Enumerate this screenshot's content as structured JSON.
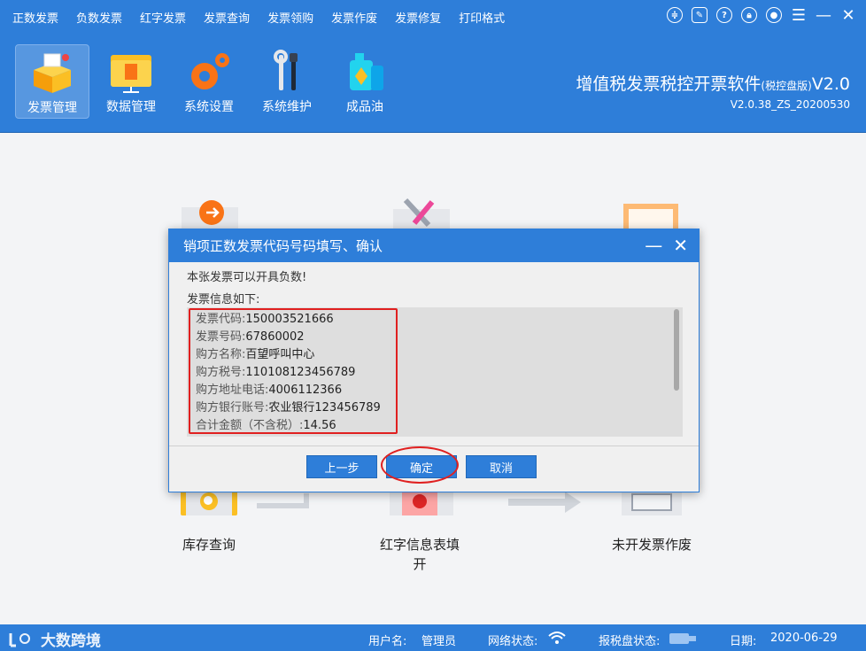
{
  "menu": [
    "正数发票",
    "负数发票",
    "红字发票",
    "发票查询",
    "发票领购",
    "发票作废",
    "发票修复",
    "打印格式"
  ],
  "toolbar": {
    "items": [
      {
        "label": "发票管理",
        "icon": "invoice-box-icon"
      },
      {
        "label": "数据管理",
        "icon": "folder-data-icon"
      },
      {
        "label": "系统设置",
        "icon": "gears-icon"
      },
      {
        "label": "系统维护",
        "icon": "tools-icon"
      },
      {
        "label": "成品油",
        "icon": "oil-can-icon"
      }
    ],
    "title": "增值税发票税控开票软件",
    "title_sub": "(税控盘版)",
    "title_ver": "V2.0",
    "version": "V2.0.38_ZS_20200530"
  },
  "main": {
    "functions": [
      {
        "label": "库存查询"
      },
      {
        "label": "红字信息表填"
      },
      {
        "label": "开"
      },
      {
        "label": "未开发票作废"
      }
    ]
  },
  "dialog": {
    "title": "销项正数发票代码号码填写、确认",
    "notice": "本张发票可以开具负数!",
    "info_heading": "发票信息如下:",
    "fields": [
      {
        "key": "发票代码:",
        "value": "150003521666"
      },
      {
        "key": "发票号码:",
        "value": "67860002"
      },
      {
        "key": "购方名称:",
        "value": "百望呼叫中心"
      },
      {
        "key": "购方税号:",
        "value": "110108123456789"
      },
      {
        "key": "购方地址电话:",
        "value": "4006112366"
      },
      {
        "key": "购方银行账号:",
        "value": "农业银行123456789"
      },
      {
        "key": "合计金额（不含税）:",
        "value": "14.56"
      }
    ],
    "buttons": {
      "prev": "上一步",
      "ok": "确定",
      "cancel": "取消"
    }
  },
  "status": {
    "logo": "大数跨境",
    "user_label": "用户名:",
    "user": "管理员",
    "network_label": "网络状态:",
    "disk_label": "报税盘状态:",
    "date_label": "日期:",
    "date": "2020-06-29"
  },
  "colors": {
    "primary": "#2e7ed9",
    "highlight": "#e02020"
  }
}
